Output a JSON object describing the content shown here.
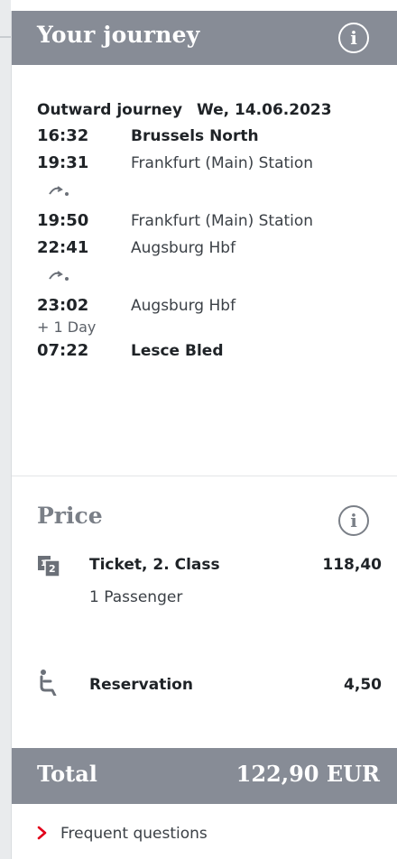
{
  "header": {
    "title": "Your journey",
    "info_glyph": "i"
  },
  "journey": {
    "outward_label": "Outward journey",
    "date": "We, 14.06.2023",
    "stops": [
      {
        "time": "16:32",
        "station": "Brussels North"
      },
      {
        "time": "19:31",
        "station": "Frankfurt (Main) Station"
      },
      {
        "time": "19:50",
        "station": "Frankfurt (Main) Station"
      },
      {
        "time": "22:41",
        "station": "Augsburg Hbf"
      },
      {
        "time": "23:02",
        "station": "Augsburg Hbf"
      },
      {
        "time": "07:22",
        "station": "Lesce Bled"
      }
    ],
    "day_offset": "+ 1 Day"
  },
  "price": {
    "title": "Price",
    "info_glyph": "i",
    "items": [
      {
        "icon": "ticket-icon",
        "label": "Ticket, 2. Class",
        "amount": "118,40",
        "sub": "1 Passenger"
      },
      {
        "icon": "seat-icon",
        "label": "Reservation",
        "amount": "4,50"
      }
    ]
  },
  "total": {
    "label": "Total",
    "amount": "122,90 EUR"
  },
  "faq": {
    "label": "Frequent questions",
    "icon": "chevron-right-icon"
  },
  "colors": {
    "header_bg": "#878c96",
    "chevron": "#e2001a",
    "text": "#2b2f33"
  }
}
